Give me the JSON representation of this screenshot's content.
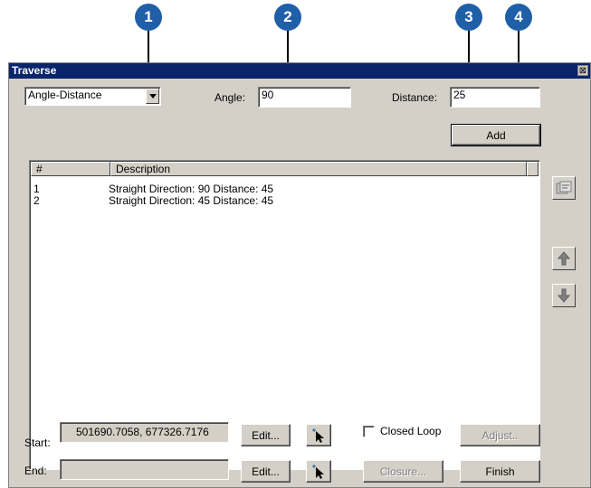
{
  "callouts": [
    "1",
    "2",
    "3",
    "4"
  ],
  "window": {
    "title": "Traverse",
    "close_glyph": "⊠"
  },
  "mode_select": {
    "value": "Angle-Distance",
    "icon": "chevron-down-icon"
  },
  "angle": {
    "label": "Angle:",
    "value": "90"
  },
  "distance": {
    "label": "Distance:",
    "value": "25"
  },
  "add_button": "Add",
  "list": {
    "columns": [
      "#",
      "Description"
    ],
    "rows": [
      {
        "num": "1",
        "desc": "Straight Direction: 90 Distance: 45"
      },
      {
        "num": "2",
        "desc": "Straight Direction: 45 Distance: 45"
      }
    ]
  },
  "side_buttons": {
    "properties_icon": "properties-icon",
    "up_icon": "arrow-up-icon",
    "down_icon": "arrow-down-icon"
  },
  "start": {
    "label": "Start:",
    "value": "501690.7058,  677326.7176",
    "edit": "Edit..."
  },
  "end": {
    "label": "End:",
    "value": "",
    "edit": "Edit..."
  },
  "closed_loop": {
    "label": "Closed Loop",
    "checked": false
  },
  "adjust_button": "Adjust..",
  "closure_button": "Closure...",
  "finish_button": "Finish",
  "colors": {
    "callout": "#1f5fa8",
    "titlebar": "#0a246a",
    "dialog": "#d4d0c8"
  }
}
